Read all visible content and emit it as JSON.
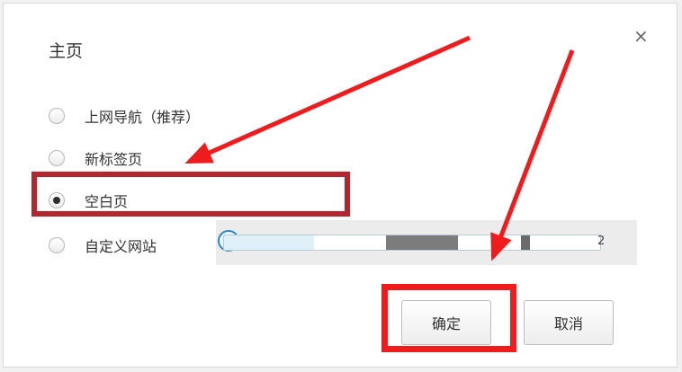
{
  "dialog": {
    "title": "主页",
    "close_symbol": "×"
  },
  "options": [
    {
      "label": "上网导航（推荐）",
      "selected": false
    },
    {
      "label": "新标签页",
      "selected": false
    },
    {
      "label": "空白页",
      "selected": true
    },
    {
      "label": "自定义网站",
      "selected": false
    }
  ],
  "custom_url": {
    "icon": "ie-icon",
    "icon_glyph": "e",
    "suffix": "2"
  },
  "buttons": {
    "ok_label": "确定",
    "cancel_label": "取消"
  },
  "annotations": {
    "highlight_border_color": "#b3262e",
    "arrow_color": "#ee1c1c"
  }
}
